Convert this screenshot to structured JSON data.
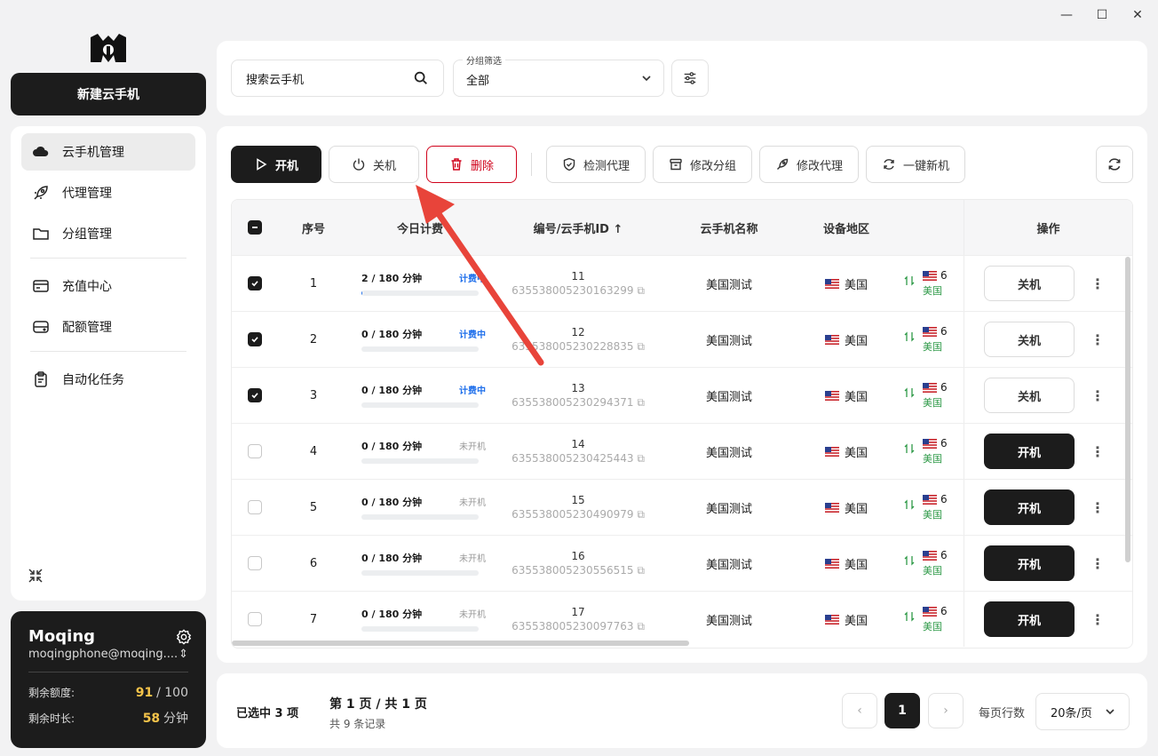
{
  "window": {
    "minimize": "—",
    "maximize": "☐",
    "close": "✕"
  },
  "sidebar": {
    "new_button": "新建云手机",
    "items": [
      {
        "label": "云手机管理",
        "icon": "cloud-icon",
        "active": true
      },
      {
        "label": "代理管理",
        "icon": "rocket-icon"
      },
      {
        "label": "分组管理",
        "icon": "folder-icon"
      },
      {
        "label": "充值中心",
        "icon": "card-icon"
      },
      {
        "label": "配额管理",
        "icon": "storage-icon"
      },
      {
        "label": "自动化任务",
        "icon": "clipboard-icon"
      }
    ]
  },
  "user": {
    "name": "Moqing",
    "email": "moqingphone@moqing....",
    "quota_label": "剩余额度:",
    "quota_value": "91",
    "quota_total": "/ 100",
    "time_label": "剩余时长:",
    "time_value": "58",
    "time_unit": "分钟"
  },
  "top": {
    "search_placeholder": "搜索云手机",
    "group_caption": "分组筛选",
    "group_value": "全部"
  },
  "toolbar": {
    "start": "开机",
    "stop": "关机",
    "delete": "删除",
    "check_proxy": "检测代理",
    "edit_group": "修改分组",
    "edit_proxy": "修改代理",
    "one_click_new": "一键新机"
  },
  "table": {
    "headers": {
      "index": "序号",
      "usage": "今日计费",
      "id": "编号/云手机ID ↑",
      "name": "云手机名称",
      "region": "设备地区",
      "op": "操作"
    },
    "rows": [
      {
        "idx": "1",
        "usage": "2 / 180 分钟",
        "status": "计费中",
        "progress": 0.011,
        "num": "11",
        "cid": "635538005230163299",
        "name": "美国测试",
        "region": "美国",
        "ip": "6",
        "ip_sub": "美国",
        "action": "关机",
        "checked": true
      },
      {
        "idx": "2",
        "usage": "0 / 180 分钟",
        "status": "计费中",
        "progress": 0,
        "num": "12",
        "cid": "635538005230228835",
        "name": "美国测试",
        "region": "美国",
        "ip": "6",
        "ip_sub": "美国",
        "action": "关机",
        "checked": true
      },
      {
        "idx": "3",
        "usage": "0 / 180 分钟",
        "status": "计费中",
        "progress": 0,
        "num": "13",
        "cid": "635538005230294371",
        "name": "美国测试",
        "region": "美国",
        "ip": "6",
        "ip_sub": "美国",
        "action": "关机",
        "checked": true
      },
      {
        "idx": "4",
        "usage": "0 / 180 分钟",
        "status": "未开机",
        "progress": 0,
        "num": "14",
        "cid": "635538005230425443",
        "name": "美国测试",
        "region": "美国",
        "ip": "6",
        "ip_sub": "美国",
        "action": "开机",
        "checked": false
      },
      {
        "idx": "5",
        "usage": "0 / 180 分钟",
        "status": "未开机",
        "progress": 0,
        "num": "15",
        "cid": "635538005230490979",
        "name": "美国测试",
        "region": "美国",
        "ip": "6",
        "ip_sub": "美国",
        "action": "开机",
        "checked": false
      },
      {
        "idx": "6",
        "usage": "0 / 180 分钟",
        "status": "未开机",
        "progress": 0,
        "num": "16",
        "cid": "635538005230556515",
        "name": "美国测试",
        "region": "美国",
        "ip": "6",
        "ip_sub": "美国",
        "action": "开机",
        "checked": false
      },
      {
        "idx": "7",
        "usage": "0 / 180 分钟",
        "status": "未开机",
        "progress": 0,
        "num": "17",
        "cid": "635538005230097763",
        "name": "美国测试",
        "region": "美国",
        "ip": "6",
        "ip_sub": "美国",
        "action": "开机",
        "checked": false
      }
    ]
  },
  "footer": {
    "selected": "已选中 3 项",
    "page_info": "第 1 页 / 共 1 页",
    "total": "共 9 条记录",
    "current_page": "1",
    "rows_label": "每页行数",
    "rows_value": "20条/页"
  },
  "colors": {
    "accent_blue": "#1f6feb",
    "dark": "#1c1c1c",
    "danger": "#d0021b",
    "gold": "#f5c44a",
    "annotation_arrow": "#e8443a"
  }
}
